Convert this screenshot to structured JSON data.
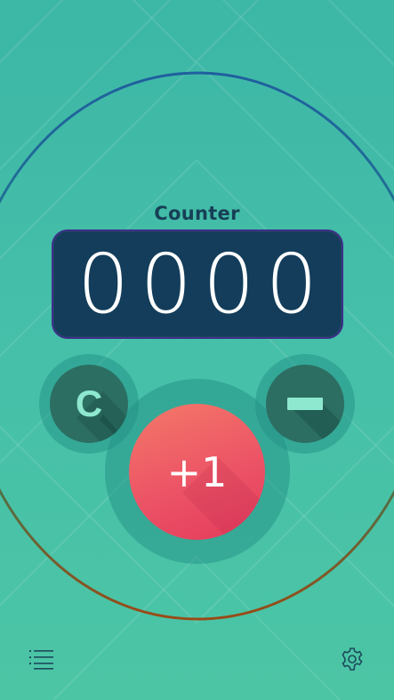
{
  "app": {
    "title": "Counter"
  },
  "counter": {
    "display_value": "0000"
  },
  "controls": {
    "clear_label": "C",
    "increment_label": "+1",
    "decrement_icon": "minus-icon"
  },
  "bottom_bar": {
    "menu_icon": "list-icon",
    "settings_icon": "gear-icon"
  },
  "colors": {
    "background": "#45bfa9",
    "display": "#133d5a",
    "increment_button": "#ec5466",
    "secondary_button": "#2c6e62",
    "secondary_glyph": "#8ee8cf",
    "ring_top": "#1f6f9c",
    "ring_bottom": "#8a4d1e"
  }
}
